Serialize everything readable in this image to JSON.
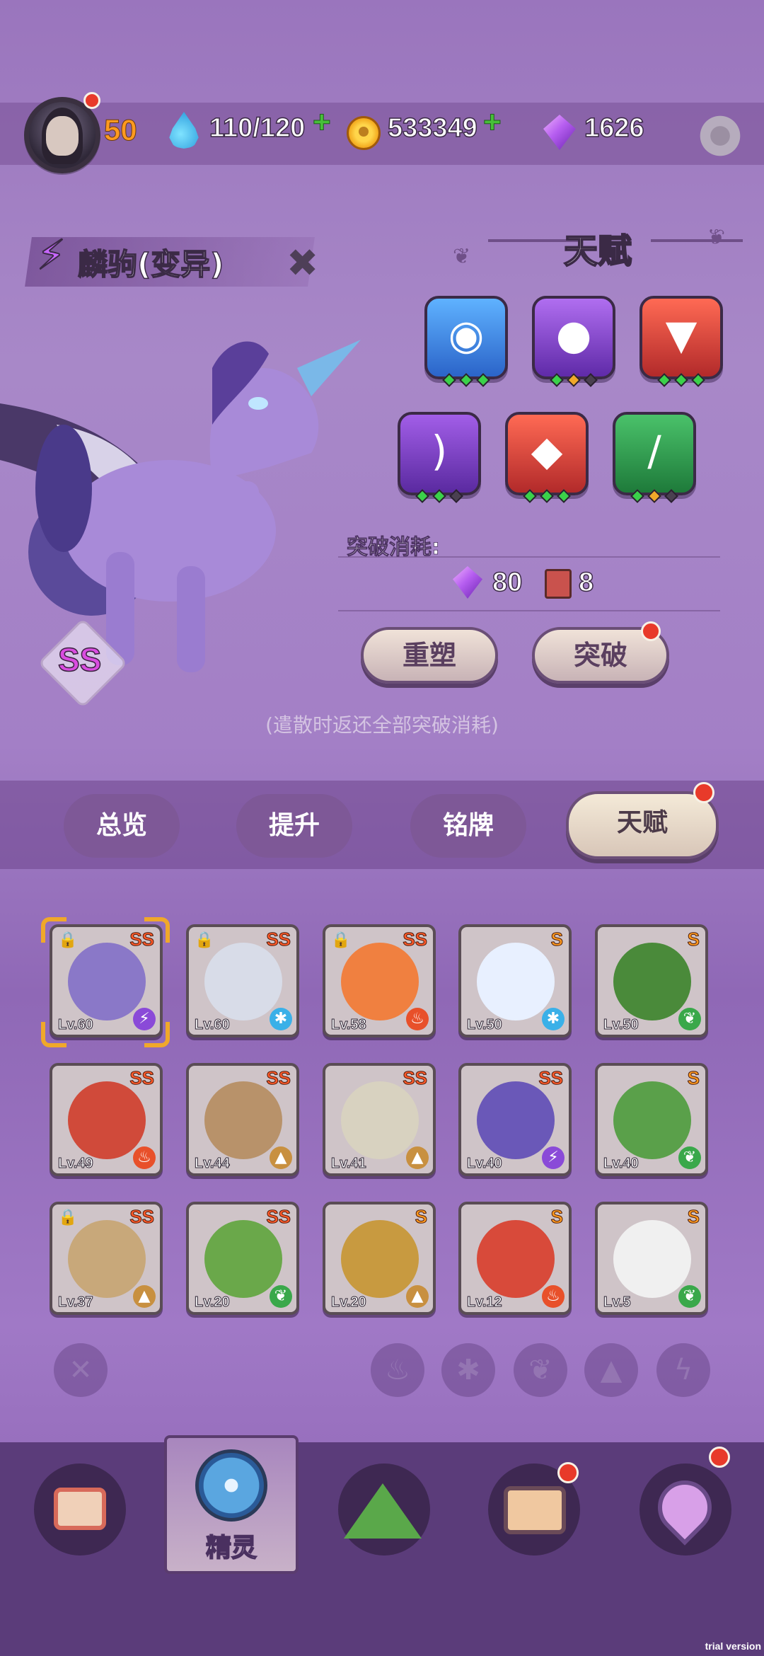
{
  "header": {
    "level": "50",
    "energy": "110/120",
    "coins": "533349",
    "gems": "1626"
  },
  "pet": {
    "name": "麟驹(变异)",
    "rank": "SS"
  },
  "talent": {
    "title": "天赋",
    "breakthrough_label": "突破消耗:",
    "gem_cost": "80",
    "book_cost": "8",
    "reshape_label": "重塑",
    "breakthrough_button": "突破",
    "note": "(遣散时返还全部突破消耗)"
  },
  "tabs": [
    "总览",
    "提升",
    "铭牌",
    "天赋"
  ],
  "pets": [
    {
      "level": "Lv.60",
      "rank": "SS"
    },
    {
      "level": "Lv.60",
      "rank": "SS"
    },
    {
      "level": "Lv.58",
      "rank": "SS"
    },
    {
      "level": "Lv.50",
      "rank": "S"
    },
    {
      "level": "Lv.50",
      "rank": "S"
    },
    {
      "level": "Lv.49",
      "rank": "SS"
    },
    {
      "level": "Lv.44",
      "rank": "SS"
    },
    {
      "level": "Lv.41",
      "rank": "SS"
    },
    {
      "level": "Lv.40",
      "rank": "SS"
    },
    {
      "level": "Lv.40",
      "rank": "S"
    },
    {
      "level": "Lv.37",
      "rank": "SS"
    },
    {
      "level": "Lv.20",
      "rank": "SS"
    },
    {
      "level": "Lv.20",
      "rank": "S"
    },
    {
      "level": "Lv.12",
      "rank": "S"
    },
    {
      "level": "Lv.5",
      "rank": "S"
    }
  ],
  "nav": {
    "spirit_label": "精灵"
  },
  "watermark": "trial version",
  "icons": {
    "settings": "gear-icon",
    "energy": "water-drop-icon",
    "coin": "coin-icon",
    "gem": "gem-icon"
  },
  "colors": {
    "accent": "#ff9a1f",
    "plus": "#47c039",
    "badge": "#e83a2a"
  }
}
